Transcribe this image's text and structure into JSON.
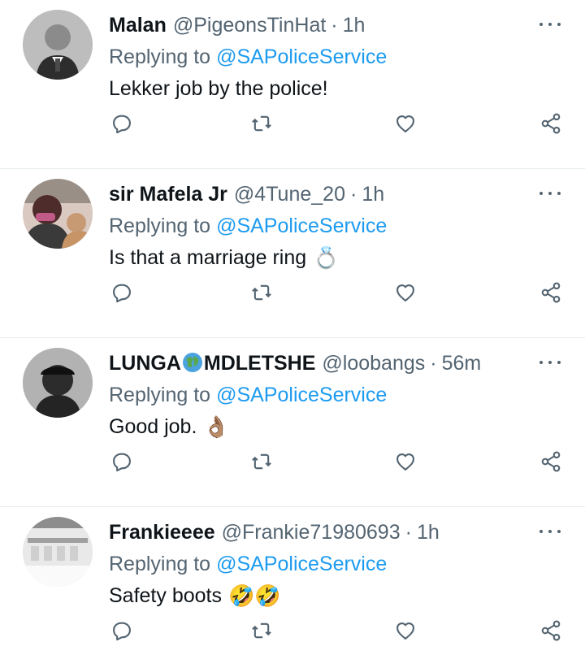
{
  "tweets": [
    {
      "name_part_1": "Malan",
      "name_part_2": "",
      "handle": "@PigeonsTinHat",
      "separator": "·",
      "time": "1h",
      "reply_label": "Replying to",
      "reply_to": "@SAPoliceService",
      "text": "Lekker job by the police!",
      "emoji": ""
    },
    {
      "name_part_1": "sir Mafela Jr",
      "name_part_2": "",
      "handle": "@4Tune_20",
      "separator": "·",
      "time": "1h",
      "reply_label": "Replying to",
      "reply_to": "@SAPoliceService",
      "text": "Is that a marriage ring",
      "emoji": "💍"
    },
    {
      "name_part_1": "LUNGA",
      "name_part_2": "MDLETSHE",
      "handle": "@loobangs",
      "separator": "·",
      "time": "56m",
      "reply_label": "Replying to",
      "reply_to": "@SAPoliceService",
      "text": "Good job.",
      "emoji": "👌🏽"
    },
    {
      "name_part_1": "Frankieeee",
      "name_part_2": "",
      "handle": "@Frankie71980693",
      "separator": "·",
      "time": "1h",
      "reply_label": "Replying to",
      "reply_to": "@SAPoliceService",
      "text": "Safety boots",
      "emoji": "🤣🤣"
    }
  ],
  "icons": {
    "reply": "reply-icon",
    "retweet": "retweet-icon",
    "like": "heart-icon",
    "share": "share-icon",
    "more": "more-icon",
    "globe": "globe-icon"
  },
  "colors": {
    "link": "#1d9bf0",
    "secondary_text": "#536471",
    "primary_text": "#0f1419",
    "divider": "#e6ecf0"
  }
}
